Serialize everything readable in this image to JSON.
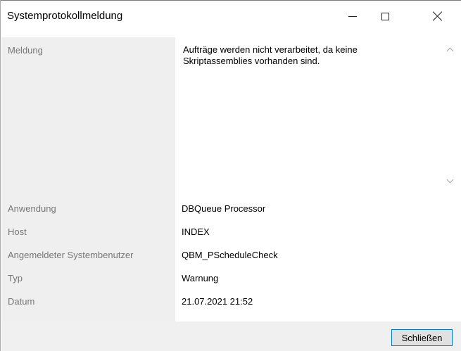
{
  "window": {
    "title": "Systemprotokollmeldung"
  },
  "fields": {
    "message": {
      "label": "Meldung",
      "value": "Aufträge werden nicht verarbeitet, da keine Skriptassemblies vorhanden sind."
    },
    "application": {
      "label": "Anwendung",
      "value": "DBQueue Processor"
    },
    "host": {
      "label": "Host",
      "value": "INDEX"
    },
    "user": {
      "label": "Angemeldeter Systembenutzer",
      "value": "QBM_PScheduleCheck"
    },
    "type": {
      "label": "Typ",
      "value": "Warnung"
    },
    "date": {
      "label": "Datum",
      "value": "21.07.2021 21:52"
    }
  },
  "footer": {
    "close_label": "Schließen"
  },
  "icons": [
    "minimize-icon",
    "maximize-icon",
    "close-icon",
    "chevron-up-icon",
    "chevron-down-icon"
  ],
  "colors": {
    "label_text": "#767676",
    "label_background": "#efefef",
    "button_border": "#0078d7"
  }
}
